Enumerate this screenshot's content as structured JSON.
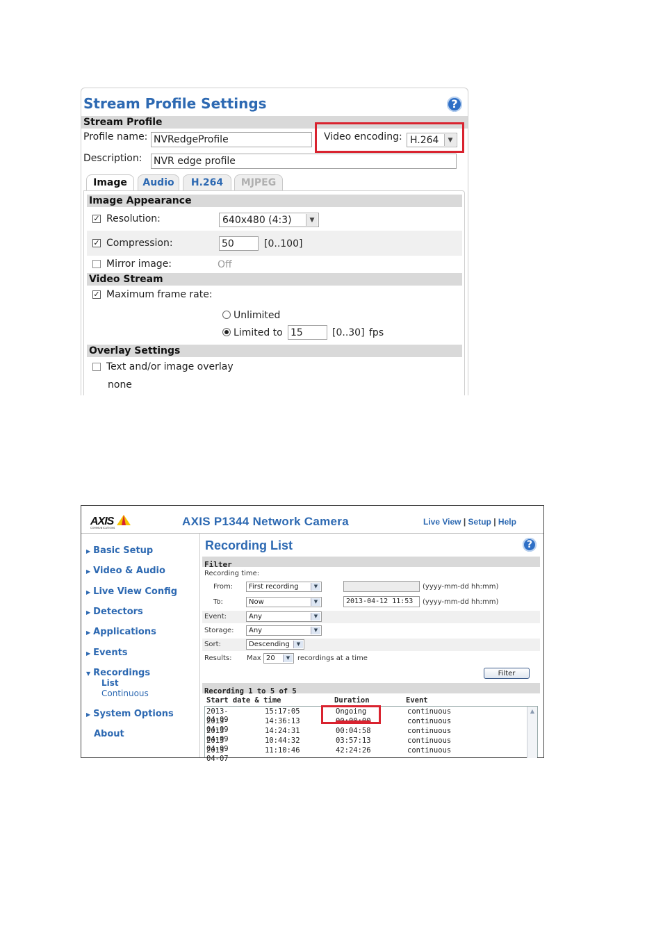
{
  "stream_profile": {
    "title": "Stream Profile Settings",
    "help_label": "?",
    "section_title": "Stream Profile",
    "profile_name_label": "Profile name:",
    "profile_name_value": "NVRedgeProfile",
    "video_encoding_label": "Video encoding:",
    "video_encoding_value": "H.264",
    "description_label": "Description:",
    "description_value": "NVR edge profile",
    "tabs": [
      "Image",
      "Audio",
      "H.264",
      "MJPEG"
    ],
    "image_appearance": {
      "title": "Image Appearance",
      "resolution_label": "Resolution:",
      "resolution_value": "640x480 (4:3)",
      "compression_label": "Compression:",
      "compression_value": "50",
      "compression_range": "[0..100]",
      "mirror_label": "Mirror image:",
      "mirror_value": "Off"
    },
    "video_stream": {
      "title": "Video Stream",
      "max_frame_rate_label": "Maximum frame rate:",
      "unlimited_label": "Unlimited",
      "limited_label": "Limited to",
      "limited_value": "15",
      "fps_range": "[0..30]",
      "fps_unit": "fps"
    },
    "overlay": {
      "title": "Overlay Settings",
      "overlay_label": "Text and/or image overlay",
      "overlay_value": "none"
    }
  },
  "camera": {
    "logo_text": "AXIS",
    "logo_sub": "COMMUNICATIONS",
    "title": "AXIS P1344 Network Camera",
    "links": {
      "live_view": "Live View",
      "setup": "Setup",
      "help": "Help",
      "sep": "|"
    },
    "sidebar": {
      "items": [
        "Basic Setup",
        "Video & Audio",
        "Live View Config",
        "Detectors",
        "Applications",
        "Events",
        "Recordings"
      ],
      "sub_items": [
        "List",
        "Continuous"
      ],
      "system_options": "System Options",
      "about": "About"
    },
    "recording_list": {
      "title": "Recording List",
      "filter_title": "Filter",
      "recording_time_label": "Recording time:",
      "from_label": "From:",
      "from_value": "First recording",
      "from_date": "",
      "date_format": "(yyyy-mm-dd hh:mm)",
      "to_label": "To:",
      "to_value": "Now",
      "to_date": "2013-04-12 11:53",
      "event_label": "Event:",
      "event_value": "Any",
      "storage_label": "Storage:",
      "storage_value": "Any",
      "sort_label": "Sort:",
      "sort_value": "Descending",
      "results_label": "Results:",
      "results_max": "Max",
      "results_value": "20",
      "results_suffix": "recordings at a time",
      "filter_button": "Filter",
      "list_header": "Recording 1 to 5 of 5",
      "columns": [
        "Start date & time",
        "Duration",
        "Event"
      ],
      "rows": [
        {
          "date": "2013-04-09",
          "time": "15:17:05",
          "duration": "Ongoing",
          "event": "continuous"
        },
        {
          "date": "2013-04-09",
          "time": "14:36:13",
          "duration": "00:00:00",
          "event": "continuous"
        },
        {
          "date": "2013-04-09",
          "time": "14:24:31",
          "duration": "00:04:58",
          "event": "continuous"
        },
        {
          "date": "2013-04-09",
          "time": "10:44:32",
          "duration": "03:57:13",
          "event": "continuous"
        },
        {
          "date": "2013-04-07",
          "time": "11:10:46",
          "duration": "42:24:26",
          "event": "continuous"
        }
      ]
    }
  },
  "colors": {
    "title_blue": "#2d69b2",
    "highlight_red": "#d9232f",
    "header_gray": "#d9d9d9"
  }
}
